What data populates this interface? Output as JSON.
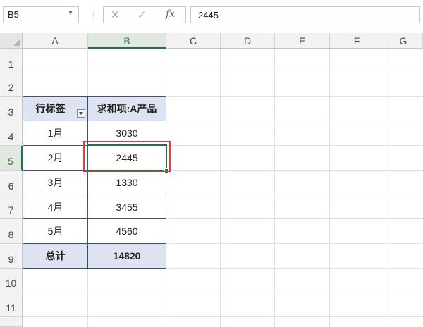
{
  "formula_bar": {
    "name_box": "B5",
    "name_box_dropdown_icon": "chevron-down-icon",
    "cancel_icon": "close-icon",
    "enter_icon": "checkmark-icon",
    "function_icon": "fx-icon",
    "value": "2445"
  },
  "sheet": {
    "columns": [
      "A",
      "B",
      "C",
      "D",
      "E",
      "F",
      "G"
    ],
    "rows": [
      "1",
      "2",
      "3",
      "4",
      "5",
      "6",
      "7",
      "8",
      "9",
      "10",
      "11"
    ],
    "selected_column": "B",
    "selected_row": "5"
  },
  "pivot": {
    "header_row_label": "行标签",
    "header_value": "求和项:A产品",
    "rows": [
      {
        "label": "1月",
        "value": "3030"
      },
      {
        "label": "2月",
        "value": "2445"
      },
      {
        "label": "3月",
        "value": "1330"
      },
      {
        "label": "4月",
        "value": "3455"
      },
      {
        "label": "5月",
        "value": "4560"
      }
    ],
    "total_label": "总计",
    "total_value": "14820",
    "header_fill": "#dde3f0"
  },
  "colors": {
    "selection": "#217346",
    "highlight_box": "#e03c3c"
  }
}
